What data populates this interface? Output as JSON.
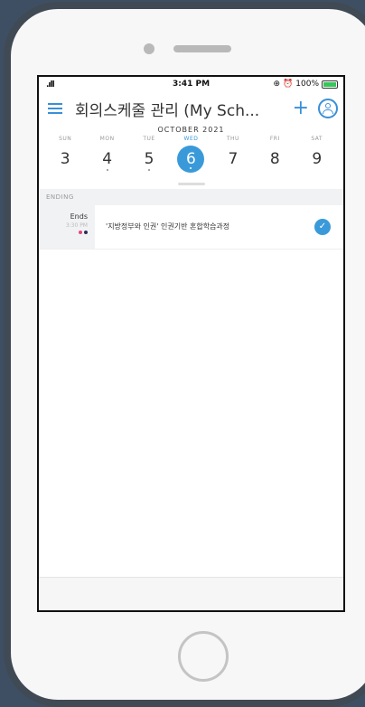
{
  "status_bar": {
    "time": "3:41 PM",
    "battery": "100%"
  },
  "header": {
    "title": "회의스케줄 관리 (My Sch..."
  },
  "calendar": {
    "month": "OCTOBER 2021",
    "days": [
      {
        "dow": "SUN",
        "num": "3"
      },
      {
        "dow": "MON",
        "num": "4"
      },
      {
        "dow": "TUE",
        "num": "5"
      },
      {
        "dow": "WED",
        "num": "6"
      },
      {
        "dow": "THU",
        "num": "7"
      },
      {
        "dow": "FRI",
        "num": "8"
      },
      {
        "dow": "SAT",
        "num": "9"
      }
    ],
    "selected_day": "6"
  },
  "sections": [
    {
      "label": "ENDING",
      "events": [
        {
          "time_label": "Ends",
          "time": "3:30 PM",
          "title": "'지방정부와 인권' 인권기반 혼합학습과정",
          "status": "completed",
          "dot_colors": [
            "#e0457b",
            "#2b2d5c"
          ]
        }
      ]
    }
  ],
  "colors": {
    "accent": "#3a9ad9"
  }
}
